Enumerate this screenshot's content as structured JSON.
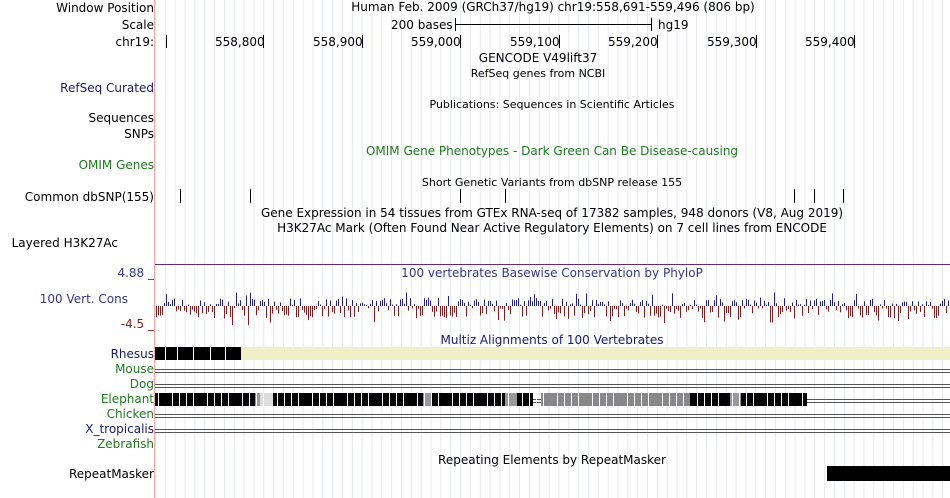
{
  "ruler": {
    "window_position_label": "Window Position",
    "scale_label": "Scale",
    "chrom_label": "chr19:",
    "assembly_text": "Human Feb. 2009 (GRCh37/hg19)   chr19:558,691-559,496 (806 bp)",
    "scale_text": "200 bases",
    "db_text": "hg19",
    "ticks": [
      "558,800",
      "558,900",
      "559,000",
      "559,100",
      "559,200",
      "559,300",
      "559,400"
    ]
  },
  "tracks": {
    "gencode": {
      "title": "GENCODE V49lift37"
    },
    "refseq": {
      "label": "RefSeq Curated",
      "title": "RefSeq genes from NCBI",
      "color": "#191970"
    },
    "publications": {
      "title": "Publications: Sequences in Scientific Articles"
    },
    "sequences": {
      "label": "Sequences"
    },
    "snps": {
      "label": "SNPs"
    },
    "omim": {
      "label": "OMIM Genes",
      "title": "OMIM Gene Phenotypes - Dark Green Can Be Disease-causing",
      "color": "#1f7a1f"
    },
    "dbsnp": {
      "label": "Common dbSNP(155)",
      "title": "Short Genetic Variants from dbSNP release 155"
    },
    "gtex": {
      "title": "Gene Expression in 54 tissues from GTEx RNA-seq of 17382 samples, 948 donors (V8, Aug 2019)"
    },
    "h3k27ac": {
      "label": "Layered H3K27Ac",
      "title": "H3K27Ac Mark (Often Found Near Active Regulatory Elements) on 7 cell lines from ENCODE"
    },
    "phylop": {
      "label": "100 Vert. Cons",
      "max": "4.88 _",
      "min": "-4.5 _",
      "title": "100 vertebrates Basewise Conservation by PhyloP",
      "color": "#36368a",
      "neg_color": "#8b1a1a"
    },
    "multiz": {
      "title": "Multiz Alignments of 100 Vertebrates",
      "species": [
        {
          "name": "Rhesus",
          "color": "#191970"
        },
        {
          "name": "Mouse",
          "color": "#1f7a1f"
        },
        {
          "name": "Dog",
          "color": "#1f7a1f"
        },
        {
          "name": "Elephant",
          "color": "#1f7a1f"
        },
        {
          "name": "Chicken",
          "color": "#1f7a1f"
        },
        {
          "name": "X_tropicalis",
          "color": "#191970"
        },
        {
          "name": "Zebrafish",
          "color": "#1f7a1f"
        }
      ]
    },
    "repeatmasker": {
      "label": "RepeatMasker",
      "title": "Repeating Elements by RepeatMasker"
    }
  }
}
